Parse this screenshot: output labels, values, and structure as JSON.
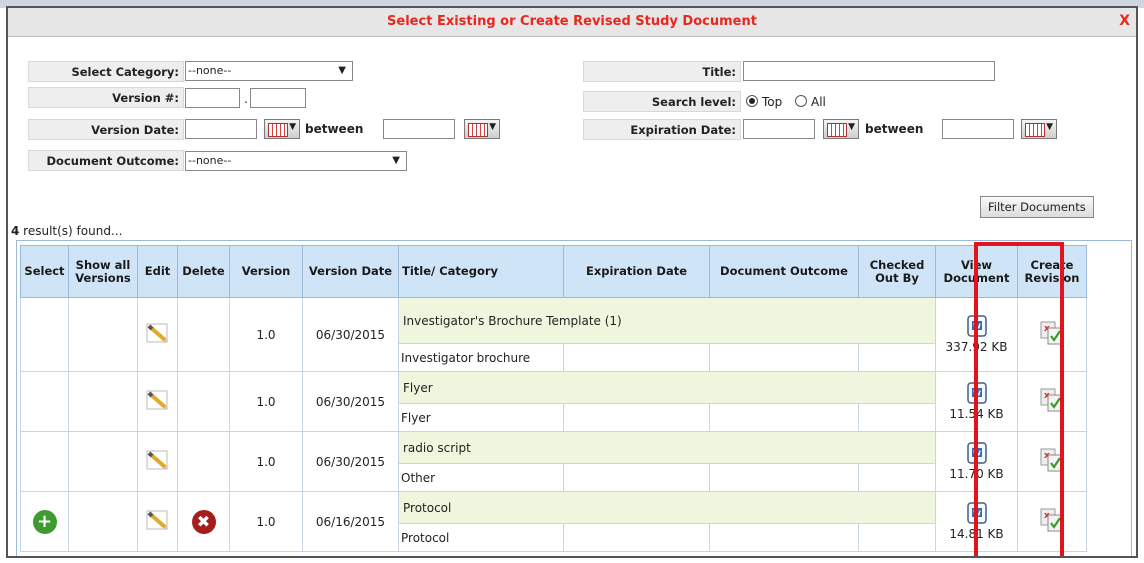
{
  "dialog": {
    "title": "Select Existing or Create Revised Study Document",
    "close": "X"
  },
  "filters": {
    "category_label": "Select Category:",
    "category_value": "--none--",
    "version_label": "Version #:",
    "version_dot": ".",
    "version_date_label": "Version Date:",
    "between": "between",
    "outcome_label": "Document Outcome:",
    "outcome_value": "--none--",
    "title_label": "Title:",
    "search_level_label": "Search level:",
    "search_top": "Top",
    "search_all": "All",
    "expiration_label": "Expiration Date:",
    "filter_button": "Filter Documents"
  },
  "results": {
    "count": "4",
    "suffix": " result(s) found..."
  },
  "table": {
    "headers": [
      "Select",
      "Show all Versions",
      "Edit",
      "Delete",
      "Version",
      "Version Date",
      "Title/ Category",
      "Expiration Date",
      "Document Outcome",
      "Checked Out By",
      "View Document",
      "Create Revision"
    ],
    "rows": [
      {
        "version": "1.0",
        "date": "06/30/2015",
        "title": "Investigator's Brochure Template (1)",
        "category": "Investigator brochure",
        "size": "337.92 KB",
        "select": false,
        "delete": false
      },
      {
        "version": "1.0",
        "date": "06/30/2015",
        "title": "Flyer",
        "category": "Flyer",
        "size": "11.54 KB",
        "select": false,
        "delete": false
      },
      {
        "version": "1.0",
        "date": "06/30/2015",
        "title": "radio script",
        "category": "Other",
        "size": "11.70 KB",
        "select": false,
        "delete": false
      },
      {
        "version": "1.0",
        "date": "06/16/2015",
        "title": "Protocol",
        "category": "Protocol",
        "size": "14.81 KB",
        "select": true,
        "delete": true
      }
    ]
  },
  "icons": {
    "edit": "pencil-icon",
    "delete": "delete-icon",
    "select": "add-icon",
    "view": "word-document-icon",
    "revision": "create-revision-icon",
    "calendar": "calendar-icon"
  },
  "colors": {
    "title_red": "#e8271f",
    "header_blue": "#cfe4f7",
    "title_green": "#eef7dd",
    "highlight": "#e0141a"
  }
}
